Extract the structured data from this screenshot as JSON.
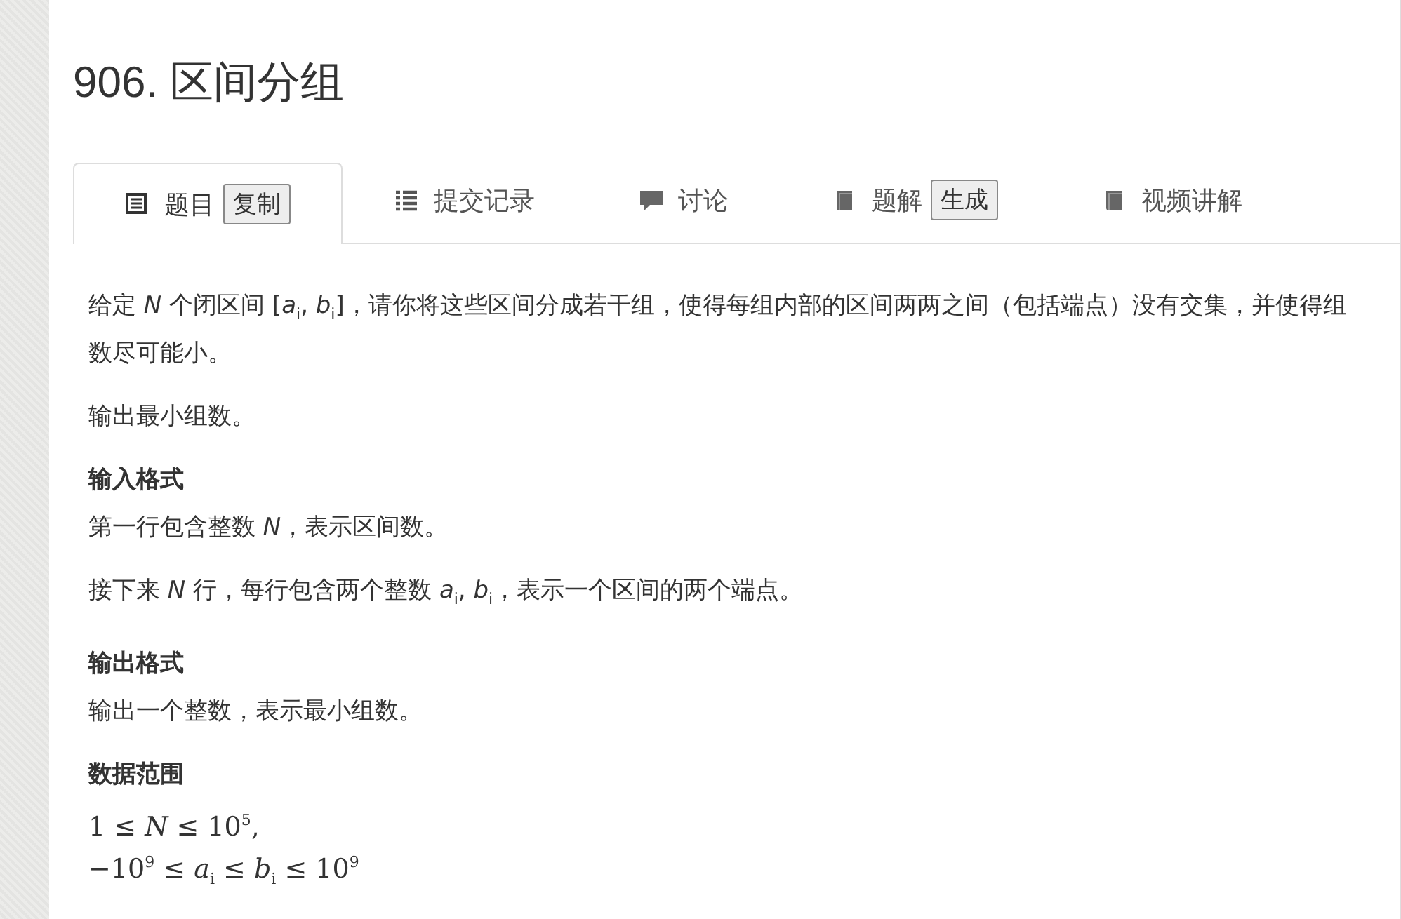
{
  "title": "906. 区间分组",
  "tabs": [
    {
      "label": "题目",
      "kind": "document",
      "selected": true,
      "button": "复制"
    },
    {
      "label": "提交记录",
      "kind": "list",
      "selected": false
    },
    {
      "label": "讨论",
      "kind": "comment",
      "selected": false
    },
    {
      "label": "题解",
      "kind": "book",
      "selected": false,
      "button": "生成"
    },
    {
      "label": "视频讲解",
      "kind": "book",
      "selected": false
    }
  ],
  "content": [
    {
      "kind": "paragraph",
      "text": "给定 *N* 个闭区间 [*a*$_{i}$, *b*$_{i}$]，请你将这些区间分成若干组，使得每组内部的区间两两之间（包括端点）没有交集，并使得组数尽可能小。"
    },
    {
      "kind": "paragraph",
      "text": "输出最小组数。"
    },
    {
      "kind": "heading",
      "text": "输入格式"
    },
    {
      "kind": "paragraph",
      "text": "第一行包含整数 *N*，表示区间数。"
    },
    {
      "kind": "paragraph",
      "text": "接下来 *N* 行，每行包含两个整数 *a*$_{i}$, *b*$_{i}$，表示一个区间的两个端点。"
    },
    {
      "kind": "heading",
      "text": "输出格式"
    },
    {
      "kind": "paragraph",
      "text": "输出一个整数，表示最小组数。"
    },
    {
      "kind": "heading",
      "text": "数据范围"
    },
    {
      "kind": "math",
      "text": "1 ≤ *N* ≤ 10$^{5}$,"
    },
    {
      "kind": "math",
      "text": "−10$^{9}$ ≤ *a*$_{i}$ ≤ *b*$_{i}$ ≤ 10$^{9}$"
    }
  ]
}
